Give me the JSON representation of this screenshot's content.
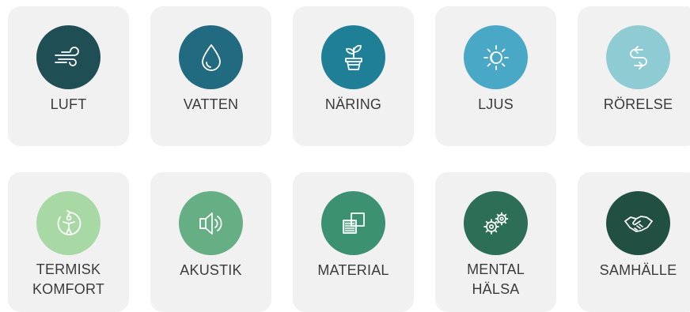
{
  "tiles": [
    {
      "label": "LUFT",
      "icon": "wind-icon",
      "color": "#1f4e55"
    },
    {
      "label": "VATTEN",
      "icon": "water-drop-icon",
      "color": "#226a7f"
    },
    {
      "label": "NÄRING",
      "icon": "potted-plant-icon",
      "color": "#1e7f97"
    },
    {
      "label": "LJUS",
      "icon": "sun-icon",
      "color": "#4aa8c7"
    },
    {
      "label": "RÖRELSE",
      "icon": "exchange-arrows-icon",
      "color": "#8ecbd3"
    },
    {
      "label": "TERMISK\nKOMFORT",
      "icon": "thermal-comfort-person-icon",
      "color": "#a8d9a5"
    },
    {
      "label": "AKUSTIK",
      "icon": "speaker-icon",
      "color": "#66ae84"
    },
    {
      "label": "MATERIAL",
      "icon": "material-layers-icon",
      "color": "#3c9270"
    },
    {
      "label": "MENTAL\nHÄLSA",
      "icon": "gears-icon",
      "color": "#2c6f56"
    },
    {
      "label": "SAMHÄLLE",
      "icon": "handshake-icon",
      "color": "#214f41"
    }
  ]
}
